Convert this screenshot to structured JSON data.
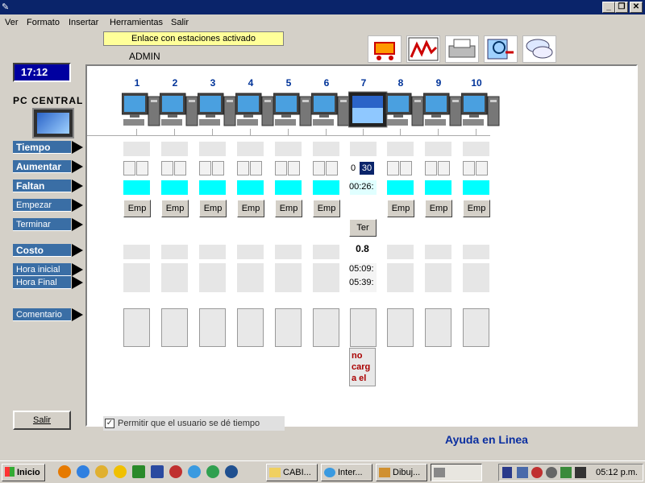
{
  "menu": [
    "Ver",
    "Formato",
    "Insertar",
    "Herramientas",
    "Salir"
  ],
  "status_text": "Enlace con estaciones activado",
  "user": "ADMIN",
  "clock": "17:12",
  "pc_label": "PC CENTRAL",
  "labels": {
    "tiempo": "Tiempo",
    "aumentar": "Aumentar",
    "faltan": "Faltan",
    "empezar": "Empezar",
    "terminar": "Terminar",
    "costo": "Costo",
    "hora_inicial": "Hora inicial",
    "hora_final": "Hora Final",
    "comentario": "Comentario"
  },
  "salir_button": "Salir",
  "stations": [
    "1",
    "2",
    "3",
    "4",
    "5",
    "6",
    "7",
    "8",
    "9",
    "10"
  ],
  "emp_label": "Emp",
  "active_station": {
    "aumentar_left": "0",
    "aumentar_right": "30",
    "faltan": "00:26:",
    "ter_label": "Ter",
    "costo": "0.8",
    "hora_inicial": "05:09:",
    "hora_final": "05:39:",
    "comentario": "no carg a el"
  },
  "checkbox_label": "Permitir que el usuario se dé tiempo",
  "help_text": "Ayuda en Linea",
  "taskbar": {
    "start": "Inicio",
    "tasks": [
      "CABI...",
      "Inter...",
      "Dibuj..."
    ],
    "time": "05:12 p.m."
  }
}
